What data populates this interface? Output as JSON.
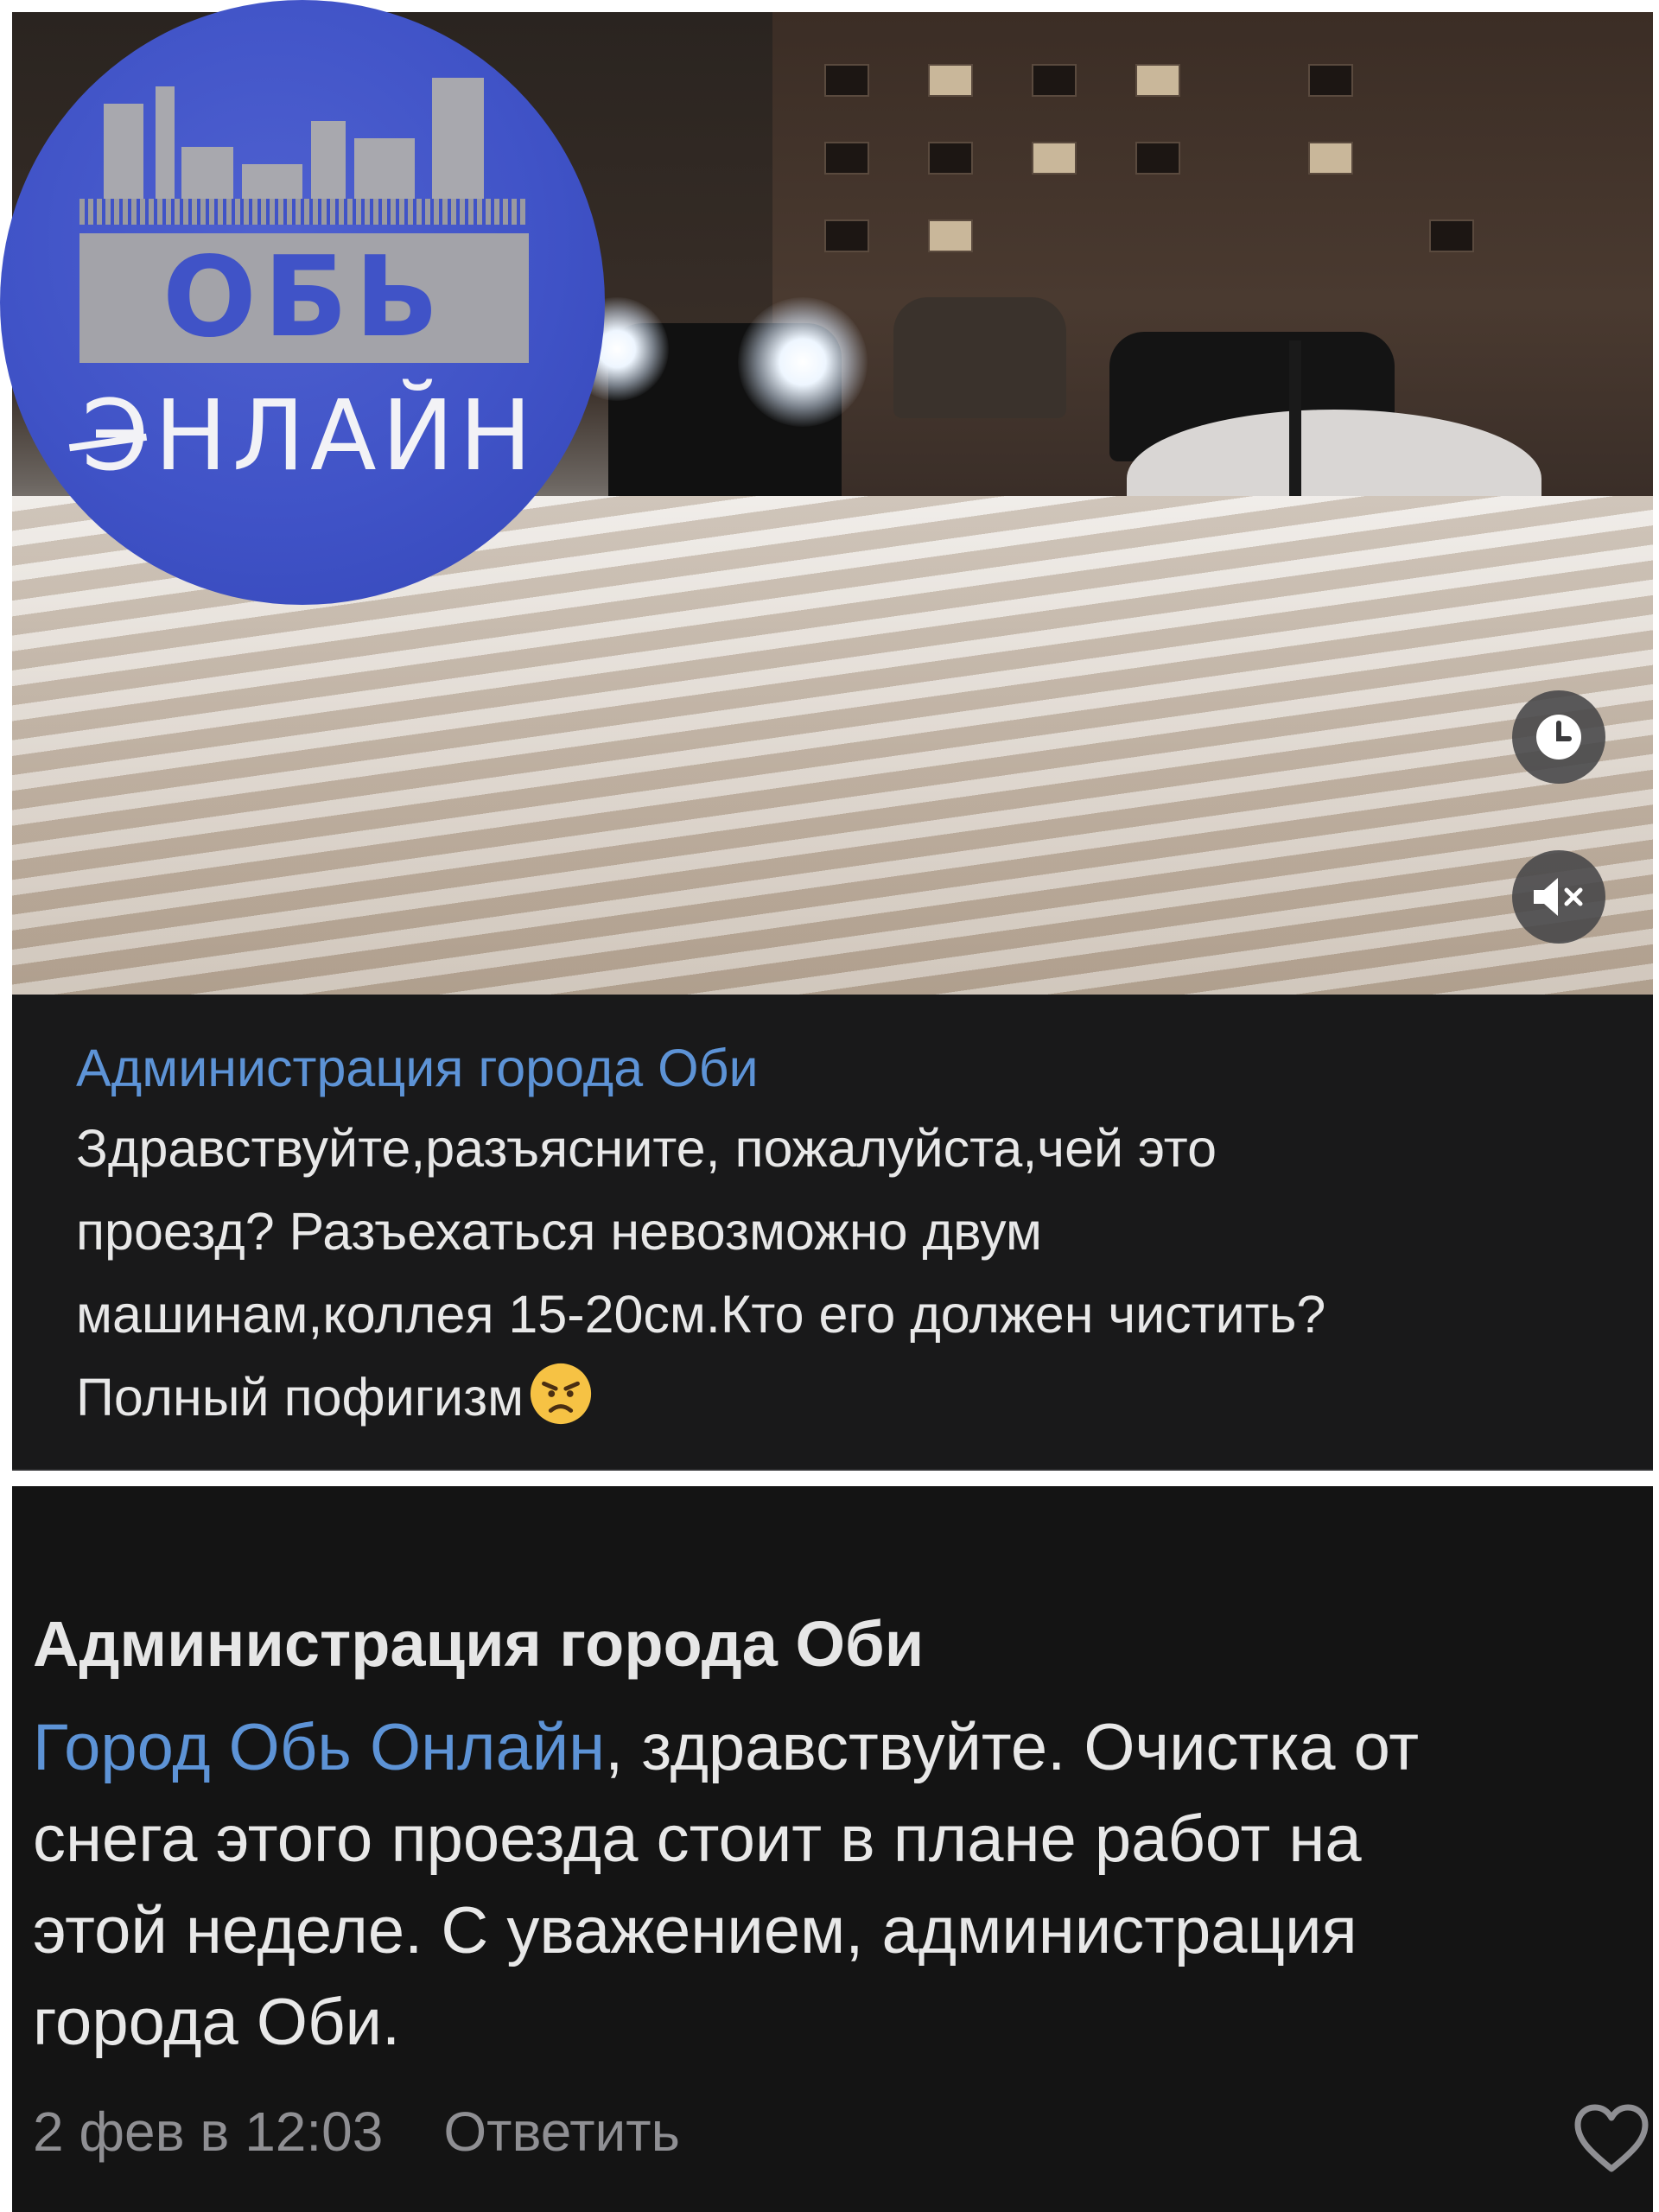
{
  "logo": {
    "line1": "ОБЬ",
    "line2": "ЭНЛАЙН"
  },
  "video": {
    "icons": [
      "clock-icon",
      "mute-icon"
    ]
  },
  "post": {
    "author": "Администрация города Оби",
    "line1": "Здравствуйте,разъясните, пожалуйста,чей это",
    "line2": "проезд? Разъехаться невозможно двум",
    "line3": "машинам,коллея 15-20см.Кто его должен чистить?",
    "line4": "Полный пофигизм",
    "emoji": "angry-face"
  },
  "reply": {
    "author": "Администрация города Оби",
    "mention": "Город Обь Онлайн",
    "text_part1": ", здравствуйте. Очистка от",
    "line2": "снега этого проезда стоит в плане работ на",
    "line3": "этой неделе. С уважением, администрация",
    "line4": "города Оби.",
    "timestamp": "2 фев в 12:03",
    "reply_label": "Ответить"
  },
  "colors": {
    "link": "#5d93d6",
    "panel_bg": "#19191a",
    "logo_blue": "#4053c7"
  }
}
